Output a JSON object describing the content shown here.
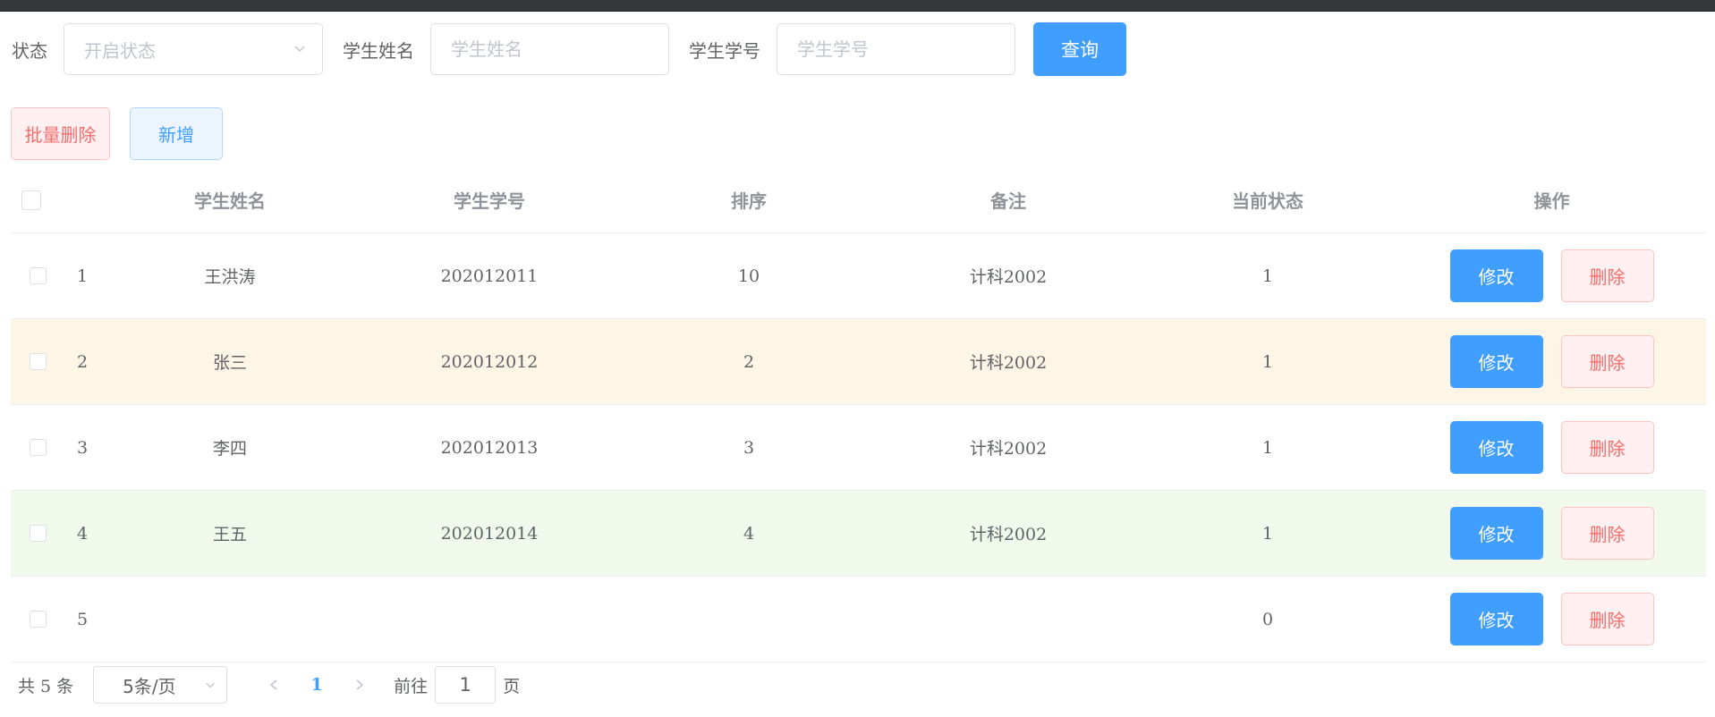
{
  "search": {
    "status_label": "状态",
    "status_placeholder": "开启状态",
    "name_label": "学生姓名",
    "name_placeholder": "学生姓名",
    "sid_label": "学生学号",
    "sid_placeholder": "学生学号",
    "query_label": "查询"
  },
  "toolbar": {
    "batch_delete_label": "批量删除",
    "add_label": "新增"
  },
  "table": {
    "columns": [
      "学生姓名",
      "学生学号",
      "排序",
      "备注",
      "当前状态",
      "操作"
    ],
    "rows": [
      {
        "index": "1",
        "name": "王洪涛",
        "sid": "202012011",
        "order": "10",
        "remark": "计科2002",
        "state": "1",
        "edit": "修改",
        "delete": "删除"
      },
      {
        "index": "2",
        "name": "张三",
        "sid": "202012012",
        "order": "2",
        "remark": "计科2002",
        "state": "1",
        "edit": "修改",
        "delete": "删除"
      },
      {
        "index": "3",
        "name": "李四",
        "sid": "202012013",
        "order": "3",
        "remark": "计科2002",
        "state": "1",
        "edit": "修改",
        "delete": "删除"
      },
      {
        "index": "4",
        "name": "王五",
        "sid": "202012014",
        "order": "4",
        "remark": "计科2002",
        "state": "1",
        "edit": "修改",
        "delete": "删除"
      },
      {
        "index": "5",
        "name": "",
        "sid": "",
        "order": "",
        "remark": "",
        "state": "0",
        "edit": "修改",
        "delete": "删除"
      }
    ]
  },
  "pagination": {
    "total_text": "共 5 条",
    "page_size": "5条/页",
    "current_page": "1",
    "goto_label": "前往",
    "goto_value": "1",
    "page_suffix": "页"
  },
  "colors": {
    "primary": "#409eff",
    "danger": "#f56c6c",
    "warning_row": "#fdf5e6",
    "success_row": "#f0f9eb"
  },
  "icons": {
    "select_arrow": "chevron-down-icon",
    "prev": "chevron-left-icon",
    "next": "chevron-right-icon"
  }
}
